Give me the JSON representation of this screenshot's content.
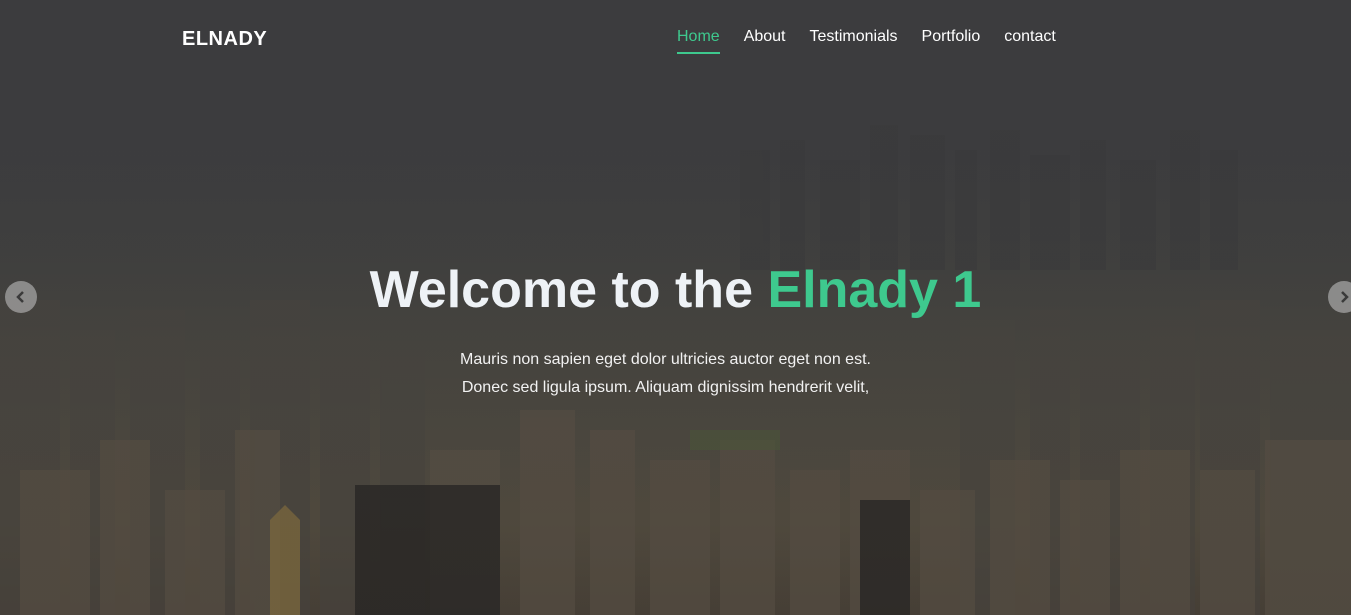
{
  "brand": {
    "name": "ELNADY"
  },
  "nav": {
    "items": [
      {
        "label": "Home",
        "active": true
      },
      {
        "label": "About"
      },
      {
        "label": "Testimonials"
      },
      {
        "label": "Portfolio"
      },
      {
        "label": "contact"
      }
    ]
  },
  "hero": {
    "title_prefix": "Welcome to the",
    "title_accent": "Elnady 1",
    "text_line1": "Mauris non sapien eget dolor ultricies auctor eget non est.",
    "text_line2": "Donec sed ligula ipsum. Aliquam dignissim hendrerit velit,"
  },
  "slider": {
    "prev_icon": "chevron-left-icon",
    "next_icon": "chevron-right-icon"
  },
  "colors": {
    "accent": "#3ec98e",
    "text": "#ffffff"
  }
}
